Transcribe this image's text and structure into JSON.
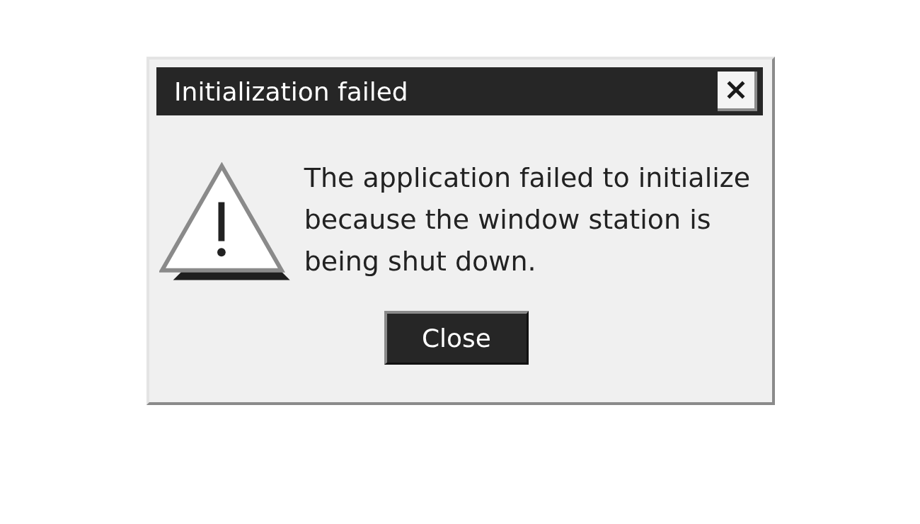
{
  "dialog": {
    "title": "Initialization failed",
    "message": "The application failed to initialize because the window station is being shut down.",
    "buttons": [
      {
        "label": "Close"
      }
    ]
  }
}
